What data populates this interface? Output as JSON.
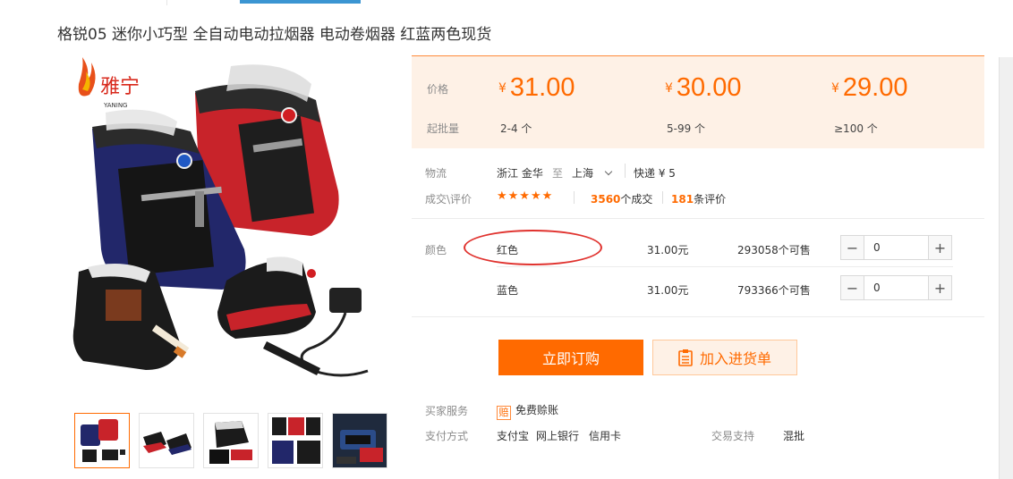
{
  "product": {
    "title": "格锐05 迷你小巧型 全自动电动拉烟器 电动卷烟器 红蓝两色现货"
  },
  "brand": {
    "logo_text": "雅宁",
    "logo_sub": "YANING"
  },
  "price_block": {
    "price_label": "价格",
    "moq_label": "起批量",
    "currency": "¥",
    "tiers": [
      {
        "price": "31.00",
        "qty": "2-4 个"
      },
      {
        "price": "30.00",
        "qty": "5-99 个"
      },
      {
        "price": "29.00",
        "qty": "≥100 个"
      }
    ]
  },
  "logistics": {
    "label": "物流",
    "from": "浙江 金华",
    "to_word": "至",
    "to": "上海",
    "method": "快递 ¥ 5"
  },
  "reviews": {
    "label": "成交\\评价",
    "stars": "★★★★★",
    "deals_count": "3560",
    "deals_suffix": "个成交",
    "review_count": "181",
    "review_suffix": "条评价"
  },
  "variants": {
    "label": "颜色",
    "items": [
      {
        "name": "红色",
        "price": "31.00元",
        "stock": "293058个可售",
        "qty": "0"
      },
      {
        "name": "蓝色",
        "price": "31.00元",
        "stock": "793366个可售",
        "qty": "0"
      }
    ]
  },
  "actions": {
    "buy_label": "立即订购",
    "cart_label": "加入进货单"
  },
  "services": {
    "buyer_label": "买家服务",
    "badge": "赔",
    "buyer_service": "免费赊账",
    "payment_label": "支付方式",
    "payment_methods": [
      "支付宝",
      "网上银行",
      "信用卡"
    ],
    "trade_label": "交易支持",
    "trade_value": "混批"
  },
  "colors": {
    "accent": "#ff6a00",
    "price_bg": "#fef1e6",
    "annotation": "#e0322e"
  }
}
